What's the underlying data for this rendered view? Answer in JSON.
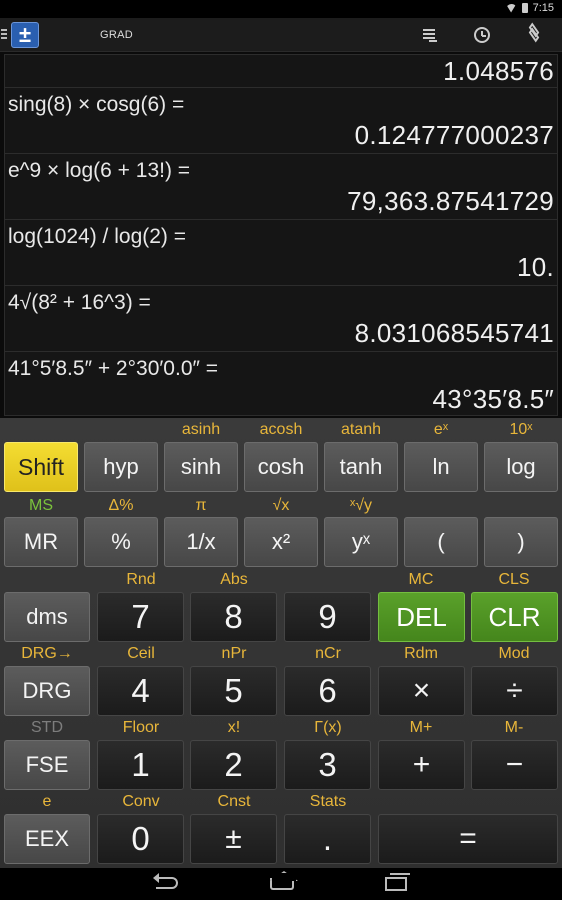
{
  "status_bar": {
    "time": "7:15",
    "wifi_icon": "wifi-icon",
    "battery_icon": "battery-icon"
  },
  "action_bar": {
    "app_icon_glyph": "±",
    "angle_mode": "GRAD",
    "icons": [
      "history-icon",
      "timer-icon",
      "layers-icon"
    ]
  },
  "history": [
    {
      "expression": "",
      "result": "1.048576"
    },
    {
      "expression": "sing(8) × cosg(6) =",
      "result": "0.124777000237"
    },
    {
      "expression": "e^9 × log(6 + 13!) =",
      "result": "79,363.87541729"
    },
    {
      "expression": "log(1024) / log(2) =",
      "result": "10."
    },
    {
      "expression": "4√(8² + 16^3) =",
      "result": "8.031068545741"
    },
    {
      "expression": "41°5′8.5″ + 2°30′0.0″ =",
      "result": "43°35′8.5″"
    }
  ],
  "keypad": {
    "row1": {
      "shift": {
        "label": "Shift"
      },
      "hyp": {
        "label": "hyp"
      },
      "sinh": {
        "label": "sinh",
        "secondary": "asinh"
      },
      "cosh": {
        "label": "cosh",
        "secondary": "acosh"
      },
      "tanh": {
        "label": "tanh",
        "secondary": "atanh"
      },
      "ln": {
        "label": "ln",
        "secondary": "eˣ"
      },
      "log": {
        "label": "log",
        "secondary": "10ˣ"
      }
    },
    "row2": {
      "mr": {
        "label": "MR",
        "secondary": "MS"
      },
      "percent": {
        "label": "%",
        "secondary": "Δ%"
      },
      "recip": {
        "label": "1/x",
        "secondary": "π"
      },
      "square": {
        "label": "x²",
        "secondary": "√x"
      },
      "power": {
        "label": "yˣ",
        "secondary": "ˣ√y"
      },
      "lparen": {
        "label": "("
      },
      "rparen": {
        "label": ")"
      }
    },
    "row3": {
      "dms": {
        "label": "dms"
      },
      "seven": {
        "label": "7",
        "secondary": "Rnd"
      },
      "eight": {
        "label": "8",
        "secondary": "Abs"
      },
      "nine": {
        "label": "9"
      },
      "del": {
        "label": "DEL",
        "secondary": "MC"
      },
      "clr": {
        "label": "CLR",
        "secondary": "CLS"
      }
    },
    "row4": {
      "drg": {
        "label": "DRG",
        "secondary": "DRG→"
      },
      "four": {
        "label": "4",
        "secondary": "Ceil"
      },
      "five": {
        "label": "5",
        "secondary": "nPr"
      },
      "six": {
        "label": "6",
        "secondary": "nCr"
      },
      "multiply": {
        "label": "×",
        "secondary": "Rdm"
      },
      "divide": {
        "label": "÷",
        "secondary": "Mod"
      }
    },
    "row5": {
      "fse": {
        "label": "FSE",
        "secondary": "STD"
      },
      "one": {
        "label": "1",
        "secondary": "Floor"
      },
      "two": {
        "label": "2",
        "secondary": "x!"
      },
      "three": {
        "label": "3",
        "secondary": "Γ(x)"
      },
      "plus": {
        "label": "+",
        "secondary": "M+"
      },
      "minus": {
        "label": "−",
        "secondary": "M-"
      }
    },
    "row6": {
      "eex": {
        "label": "EEX",
        "secondary": "e"
      },
      "zero": {
        "label": "0",
        "secondary": "Conv"
      },
      "sign": {
        "label": "±",
        "secondary": "Cnst"
      },
      "dot": {
        "label": ".",
        "secondary": "Stats"
      },
      "equals": {
        "label": "="
      }
    }
  },
  "colors": {
    "shift_label": "#e8b63a",
    "store_label": "#7bc23c",
    "disabled_label": "#7d7d7d",
    "shift_key": "#f4dd32",
    "action_key": "#5aa12a"
  },
  "navigation": {
    "icons": [
      "back-icon",
      "home-icon",
      "recent-apps-icon"
    ]
  }
}
